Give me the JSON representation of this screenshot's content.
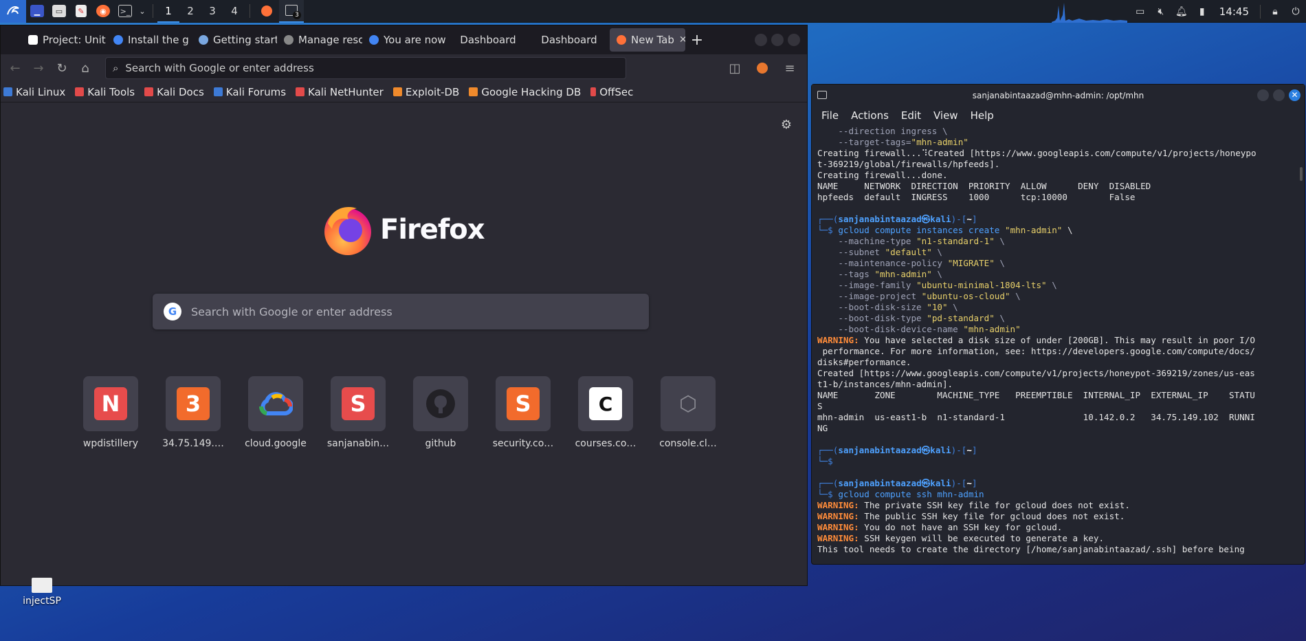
{
  "panel": {
    "workspaces": [
      "1",
      "2",
      "3",
      "4"
    ],
    "terminal_badge": "3",
    "clock": "14:45"
  },
  "firefox": {
    "tabs": [
      {
        "label": "Project: Unit",
        "fav_color": "#ffffff"
      },
      {
        "label": "Install the g",
        "fav_color": "#4285f4"
      },
      {
        "label": "Getting start",
        "fav_color": "#7aa7e0"
      },
      {
        "label": "Manage reso",
        "fav_color": "#888888"
      },
      {
        "label": "You are now",
        "fav_color": "#4285f4"
      },
      {
        "label": "Dashboard",
        "fav_color": ""
      },
      {
        "label": "Dashboard",
        "fav_color": ""
      },
      {
        "label": "New Tab",
        "fav_color": "#ff7139"
      }
    ],
    "url_placeholder": "Search with Google or enter address",
    "bookmarks": [
      {
        "label": "Kali Linux",
        "color": "#3d7ad6"
      },
      {
        "label": "Kali Tools",
        "color": "#e24a4a"
      },
      {
        "label": "Kali Docs",
        "color": "#e24a4a"
      },
      {
        "label": "Kali Forums",
        "color": "#3d7ad6"
      },
      {
        "label": "Kali NetHunter",
        "color": "#e24a4a"
      },
      {
        "label": "Exploit-DB",
        "color": "#f08a2c"
      },
      {
        "label": "Google Hacking DB",
        "color": "#f08a2c"
      },
      {
        "label": "OffSec",
        "color": "#e24a4a"
      }
    ],
    "logo_text": "Firefox",
    "search_placeholder": "Search with Google or enter address",
    "shortcuts": [
      {
        "label": "wpdistillery",
        "glyph": "N",
        "color": "#e74c4c"
      },
      {
        "label": "34.75.149.…",
        "glyph": "3",
        "color": "#f26b2c"
      },
      {
        "label": "cloud.google",
        "glyph": "☁",
        "color": "#42414d"
      },
      {
        "label": "sanjanabin…",
        "glyph": "S",
        "color": "#e74c4c"
      },
      {
        "label": "github",
        "glyph": "●",
        "color": "#42414d"
      },
      {
        "label": "security.co…",
        "glyph": "S",
        "color": "#f26b2c"
      },
      {
        "label": "courses.co…",
        "glyph": "C",
        "color": "#ffffff"
      },
      {
        "label": "console.cl…",
        "glyph": "⬡",
        "color": "#42414d"
      }
    ]
  },
  "desktop": {
    "icon_label": "injectSP"
  },
  "terminal": {
    "title": "sanjanabintaazad@mhn-admin: /opt/mhn",
    "menu": [
      "File",
      "Actions",
      "Edit",
      "View",
      "Help"
    ],
    "lines": [
      {
        "t": "    --direction ingress \\",
        "c": "opt"
      },
      {
        "t": "    --target-tags=\"mhn-admin\"",
        "c": "opt"
      },
      {
        "t": "Creating firewall...⠹Created [https://www.googleapis.com/compute/v1/projects/honeypo",
        "c": ""
      },
      {
        "t": "t-369219/global/firewalls/hpfeeds].",
        "c": ""
      },
      {
        "t": "Creating firewall...done.",
        "c": ""
      },
      {
        "t": "NAME     NETWORK  DIRECTION  PRIORITY  ALLOW      DENY  DISABLED",
        "c": ""
      },
      {
        "t": "hpfeeds  default  INGRESS    1000      tcp:10000        False",
        "c": ""
      },
      {
        "t": "",
        "c": ""
      },
      {
        "t": "┌──(sanjanabintaazad㉿kali)-[~]",
        "c": "prompt"
      },
      {
        "t": "└─$ gcloud compute instances create \"mhn-admin\" \\",
        "c": "cmdline"
      },
      {
        "t": "    --machine-type \"n1-standard-1\" \\",
        "c": "opt"
      },
      {
        "t": "    --subnet \"default\" \\",
        "c": "opt"
      },
      {
        "t": "    --maintenance-policy \"MIGRATE\" \\",
        "c": "opt"
      },
      {
        "t": "    --tags \"mhn-admin\" \\",
        "c": "opt"
      },
      {
        "t": "    --image-family \"ubuntu-minimal-1804-lts\" \\",
        "c": "opt"
      },
      {
        "t": "    --image-project \"ubuntu-os-cloud\" \\",
        "c": "opt"
      },
      {
        "t": "    --boot-disk-size \"10\" \\",
        "c": "opt"
      },
      {
        "t": "    --boot-disk-type \"pd-standard\" \\",
        "c": "opt"
      },
      {
        "t": "    --boot-disk-device-name \"mhn-admin\"",
        "c": "opt"
      },
      {
        "t": "WARNING: You have selected a disk size of under [200GB]. This may result in poor I/O",
        "c": "warn"
      },
      {
        "t": " performance. For more information, see: https://developers.google.com/compute/docs/",
        "c": ""
      },
      {
        "t": "disks#performance.",
        "c": ""
      },
      {
        "t": "Created [https://www.googleapis.com/compute/v1/projects/honeypot-369219/zones/us-eas",
        "c": ""
      },
      {
        "t": "t1-b/instances/mhn-admin].",
        "c": ""
      },
      {
        "t": "NAME       ZONE        MACHINE_TYPE   PREEMPTIBLE  INTERNAL_IP  EXTERNAL_IP    STATU",
        "c": ""
      },
      {
        "t": "S",
        "c": ""
      },
      {
        "t": "mhn-admin  us-east1-b  n1-standard-1               10.142.0.2   34.75.149.102  RUNNI",
        "c": ""
      },
      {
        "t": "NG",
        "c": ""
      },
      {
        "t": "",
        "c": ""
      },
      {
        "t": "┌──(sanjanabintaazad㉿kali)-[~]",
        "c": "prompt"
      },
      {
        "t": "└─$ ",
        "c": "cmdline"
      },
      {
        "t": "",
        "c": ""
      },
      {
        "t": "┌──(sanjanabintaazad㉿kali)-[~]",
        "c": "prompt"
      },
      {
        "t": "└─$ gcloud compute ssh mhn-admin",
        "c": "cmdline"
      },
      {
        "t": "WARNING: The private SSH key file for gcloud does not exist.",
        "c": "warn"
      },
      {
        "t": "WARNING: The public SSH key file for gcloud does not exist.",
        "c": "warn"
      },
      {
        "t": "WARNING: You do not have an SSH key for gcloud.",
        "c": "warn"
      },
      {
        "t": "WARNING: SSH keygen will be executed to generate a key.",
        "c": "warn"
      },
      {
        "t": "This tool needs to create the directory [/home/sanjanabintaazad/.ssh] before being",
        "c": ""
      }
    ]
  }
}
